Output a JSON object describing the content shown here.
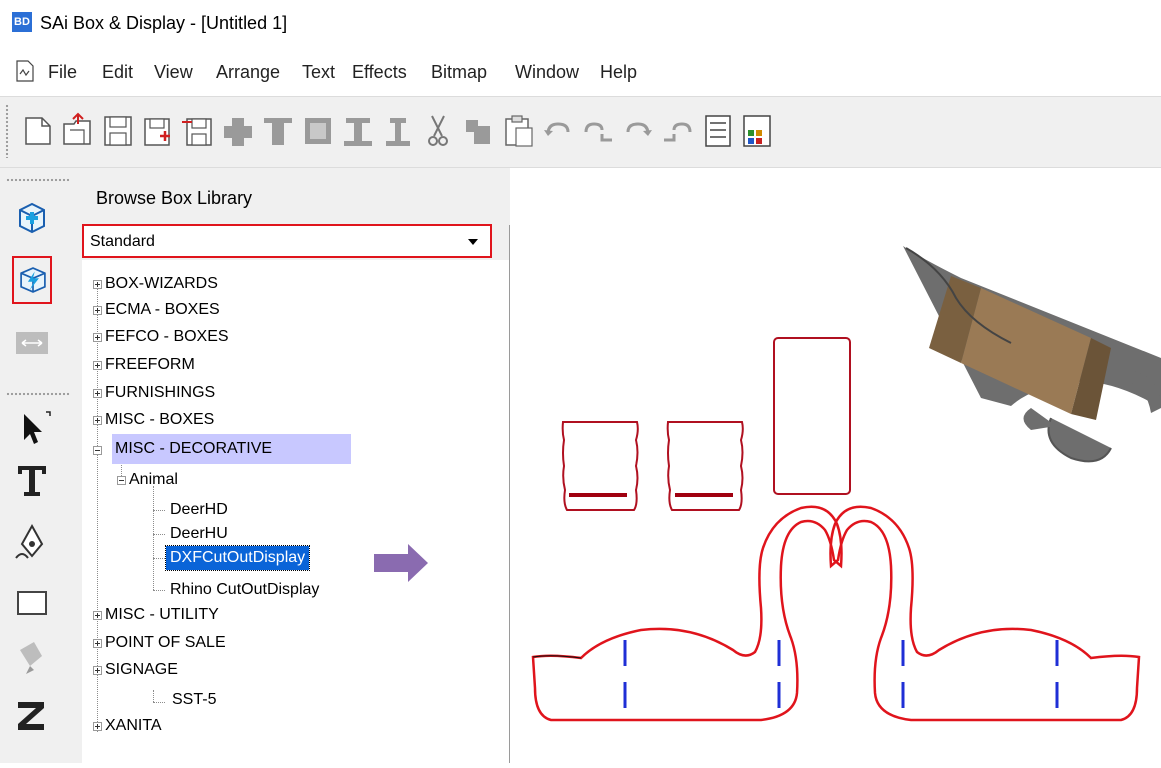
{
  "window": {
    "app_badge": "BD",
    "title": "SAi Box & Display - [Untitled 1]"
  },
  "menu": [
    "File",
    "Edit",
    "View",
    "Arrange",
    "Text",
    "Effects",
    "Bitmap",
    "Window",
    "Help"
  ],
  "toolbar": {
    "buttons": [
      "new-icon",
      "open-icon",
      "save-icon",
      "save-as-icon",
      "export-icon",
      "nudge-left-icon",
      "align-top-icon",
      "align-center-icon",
      "distribute-icon",
      "align-bottom-icon",
      "cut-icon",
      "copy-icon",
      "paste-icon",
      "undo-icon",
      "undo-multiple-icon",
      "redo-icon",
      "redo-multiple-icon",
      "properties-icon",
      "palette-icon"
    ]
  },
  "tools": [
    "new-box-icon",
    "box-library-icon",
    "dimension-icon",
    "select-arrow-icon",
    "text-tool-icon",
    "pen-tool-icon",
    "rectangle-tool-icon",
    "fill-tool-icon",
    "zoom-tool-icon"
  ],
  "panel": {
    "title": "Browse Box Library",
    "library_select": "Standard"
  },
  "tree": {
    "box_wizards": "BOX-WIZARDS",
    "ecma": "ECMA - BOXES",
    "fefco": "FEFCO - BOXES",
    "freeform": "FREEFORM",
    "furnishings": "FURNISHINGS",
    "misc_boxes": "MISC - BOXES",
    "misc_decorative": "MISC - DECORATIVE",
    "animal": "Animal",
    "deerhd": "DeerHD",
    "deerhu": "DeerHU",
    "dxf": "DXFCutOutDisplay",
    "rhino": "Rhino CutOutDisplay",
    "misc_utility": "MISC - UTILITY",
    "pos": "POINT OF SALE",
    "signage": "SIGNAGE",
    "sst5": "SST-5",
    "xanita": "XANITA"
  },
  "colors": {
    "highlight_red": "#e0141c",
    "selection": "#0a64d8",
    "category_highlight": "#c8c8ff",
    "arrow": "#8a6bb0",
    "cut_line": "#e0141c",
    "fold_line": "#1f2fd6"
  }
}
